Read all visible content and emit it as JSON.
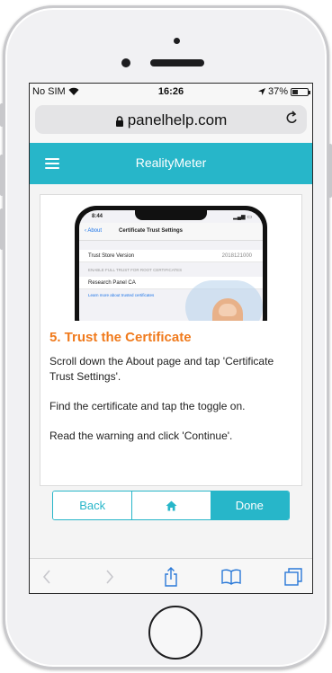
{
  "status": {
    "carrier": "No SIM",
    "time": "16:26",
    "battery": "37%",
    "battery_level": 0.37
  },
  "browser": {
    "domain": "panelhelp.com"
  },
  "app": {
    "title": "RealityMeter"
  },
  "illustration": {
    "time": "8:44",
    "back": "About",
    "nav_title": "Certificate Trust Settings",
    "row1_label": "Trust Store Version",
    "row1_value": "2018121000",
    "section": "ENABLE FULL TRUST FOR ROOT CERTIFICATES",
    "row2_label": "Research Panel CA",
    "link": "Learn more about trusted certificates"
  },
  "step": {
    "title": "5. Trust the Certificate",
    "p1": "Scroll down the About page and tap 'Certificate Trust Settings'.",
    "p2": "Find the certificate and tap the toggle on.",
    "p3": "Read the warning and click 'Continue'."
  },
  "buttons": {
    "back": "Back",
    "done": "Done"
  },
  "colors": {
    "accent": "#27b6c9",
    "step_title": "#f07a1c"
  },
  "icons": [
    "wifi-icon",
    "location-icon",
    "battery-icon",
    "lock-icon",
    "reload-icon",
    "hamburger-icon",
    "home-icon",
    "back-arrow-icon",
    "forward-arrow-icon",
    "share-icon",
    "bookmarks-icon",
    "tabs-icon"
  ]
}
